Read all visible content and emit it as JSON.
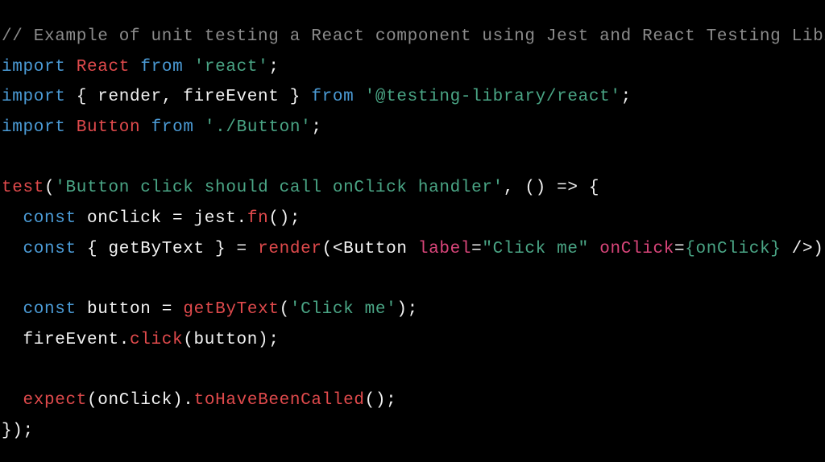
{
  "editor": {
    "language": "javascript",
    "colors": {
      "background": "#000000",
      "comment": "#8b8b8b",
      "keyword": "#4b9bd6",
      "identifier": "#e04a4c",
      "string": "#4aa585",
      "attribute": "#d9457a",
      "plain": "#f2f2f2"
    },
    "lines": [
      {
        "tokens": [
          {
            "t": "comment",
            "v": "// Example of unit testing a React component using Jest and React Testing Libi"
          }
        ]
      },
      {
        "tokens": [
          {
            "t": "keyword",
            "v": "import"
          },
          {
            "t": "plain",
            "v": " "
          },
          {
            "t": "ident",
            "v": "React"
          },
          {
            "t": "plain",
            "v": " "
          },
          {
            "t": "keyword",
            "v": "from"
          },
          {
            "t": "plain",
            "v": " "
          },
          {
            "t": "string",
            "v": "'react'"
          },
          {
            "t": "plain",
            "v": ";"
          }
        ]
      },
      {
        "tokens": [
          {
            "t": "keyword",
            "v": "import"
          },
          {
            "t": "plain",
            "v": " { render, fireEvent } "
          },
          {
            "t": "keyword",
            "v": "from"
          },
          {
            "t": "plain",
            "v": " "
          },
          {
            "t": "string",
            "v": "'@testing-library/react'"
          },
          {
            "t": "plain",
            "v": ";"
          }
        ]
      },
      {
        "tokens": [
          {
            "t": "keyword",
            "v": "import"
          },
          {
            "t": "plain",
            "v": " "
          },
          {
            "t": "ident",
            "v": "Button"
          },
          {
            "t": "plain",
            "v": " "
          },
          {
            "t": "keyword",
            "v": "from"
          },
          {
            "t": "plain",
            "v": " "
          },
          {
            "t": "string",
            "v": "'./Button'"
          },
          {
            "t": "plain",
            "v": ";"
          }
        ]
      },
      {
        "tokens": []
      },
      {
        "tokens": [
          {
            "t": "ident",
            "v": "test"
          },
          {
            "t": "plain",
            "v": "("
          },
          {
            "t": "string",
            "v": "'Button click should call onClick handler'"
          },
          {
            "t": "plain",
            "v": ", () => {"
          }
        ]
      },
      {
        "tokens": [
          {
            "t": "plain",
            "v": "  "
          },
          {
            "t": "keyword",
            "v": "const"
          },
          {
            "t": "plain",
            "v": " onClick = jest."
          },
          {
            "t": "ident",
            "v": "fn"
          },
          {
            "t": "plain",
            "v": "();"
          }
        ]
      },
      {
        "tokens": [
          {
            "t": "plain",
            "v": "  "
          },
          {
            "t": "keyword",
            "v": "const"
          },
          {
            "t": "plain",
            "v": " { getByText } = "
          },
          {
            "t": "ident",
            "v": "render"
          },
          {
            "t": "plain",
            "v": "(<Button "
          },
          {
            "t": "attr",
            "v": "label"
          },
          {
            "t": "plain",
            "v": "="
          },
          {
            "t": "string",
            "v": "\"Click me\""
          },
          {
            "t": "plain",
            "v": " "
          },
          {
            "t": "attr",
            "v": "onClick"
          },
          {
            "t": "plain",
            "v": "="
          },
          {
            "t": "string",
            "v": "{onClick}"
          },
          {
            "t": "plain",
            "v": " />);"
          }
        ]
      },
      {
        "tokens": []
      },
      {
        "tokens": [
          {
            "t": "plain",
            "v": "  "
          },
          {
            "t": "keyword",
            "v": "const"
          },
          {
            "t": "plain",
            "v": " button = "
          },
          {
            "t": "ident",
            "v": "getByText"
          },
          {
            "t": "plain",
            "v": "("
          },
          {
            "t": "string",
            "v": "'Click me'"
          },
          {
            "t": "plain",
            "v": ");"
          }
        ]
      },
      {
        "tokens": [
          {
            "t": "plain",
            "v": "  fireEvent."
          },
          {
            "t": "ident",
            "v": "click"
          },
          {
            "t": "plain",
            "v": "(button);"
          }
        ]
      },
      {
        "tokens": []
      },
      {
        "tokens": [
          {
            "t": "plain",
            "v": "  "
          },
          {
            "t": "ident",
            "v": "expect"
          },
          {
            "t": "plain",
            "v": "(onClick)."
          },
          {
            "t": "ident",
            "v": "toHaveBeenCalled"
          },
          {
            "t": "plain",
            "v": "();"
          }
        ]
      },
      {
        "tokens": [
          {
            "t": "plain",
            "v": "});"
          }
        ]
      }
    ]
  }
}
